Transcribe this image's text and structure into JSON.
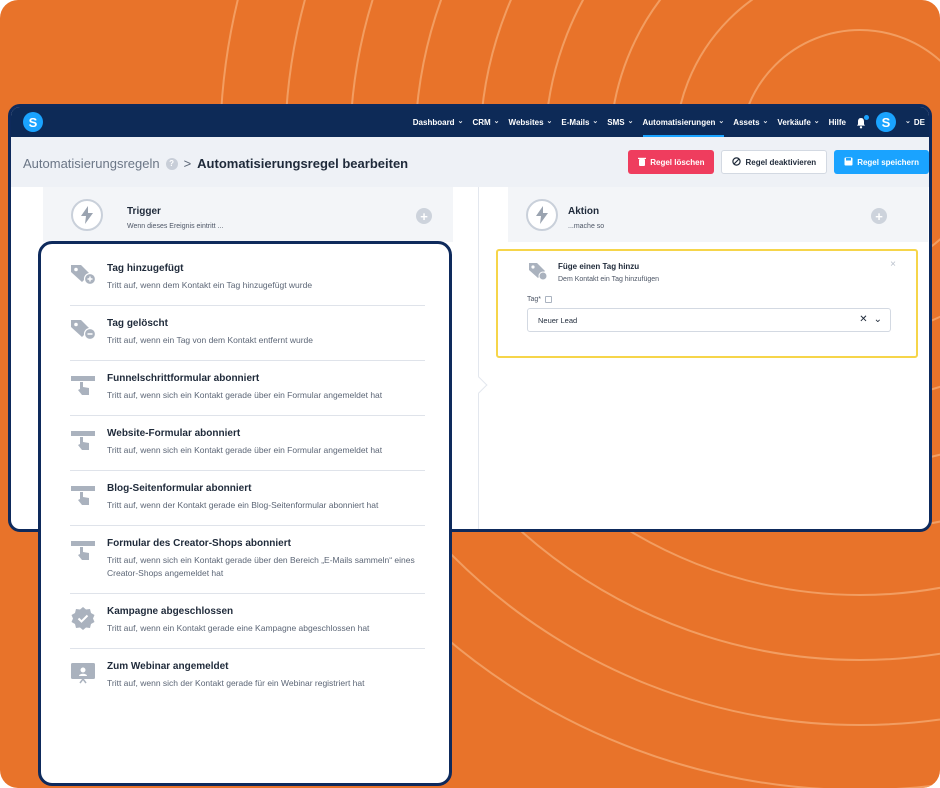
{
  "nav": {
    "items": [
      {
        "label": "Dashboard",
        "has_menu": true,
        "active": false
      },
      {
        "label": "CRM",
        "has_menu": true,
        "active": false
      },
      {
        "label": "Websites",
        "has_menu": true,
        "active": false
      },
      {
        "label": "E-Mails",
        "has_menu": true,
        "active": false
      },
      {
        "label": "SMS",
        "has_menu": true,
        "active": false
      },
      {
        "label": "Automatisierungen",
        "has_menu": true,
        "active": true
      },
      {
        "label": "Assets",
        "has_menu": true,
        "active": false
      },
      {
        "label": "Verkäufe",
        "has_menu": true,
        "active": false
      },
      {
        "label": "Hilfe",
        "has_menu": false,
        "active": false
      }
    ],
    "logo_letter": "S",
    "avatar_letter": "S",
    "language": "DE"
  },
  "breadcrumb": {
    "parent": "Automatisierungsregeln",
    "help_icon": "?",
    "separator": ">",
    "current": "Automatisierungsregel bearbeiten"
  },
  "actions": {
    "delete_label": "Regel löschen",
    "deactivate_label": "Regel deaktivieren",
    "save_label": "Regel speichern"
  },
  "trigger_header": {
    "title": "Trigger",
    "subtitle": "Wenn dieses Ereignis eintritt ..."
  },
  "action_header": {
    "title": "Aktion",
    "subtitle": "...mache so"
  },
  "action_card": {
    "title": "Füge einen Tag hinzu",
    "subtitle": "Dem Kontakt ein Tag hinzufügen",
    "field_label": "Tag*",
    "selected_value": "Neuer Lead",
    "close_glyph": "×"
  },
  "triggers": [
    {
      "title": "Tag hinzugefügt",
      "description": "Tritt auf, wenn dem Kontakt ein Tag hinzugefügt wurde",
      "icon": "tag-plus-icon"
    },
    {
      "title": "Tag gelöscht",
      "description": "Tritt auf, wenn ein Tag von dem Kontakt entfernt wurde",
      "icon": "tag-minus-icon"
    },
    {
      "title": "Funnelschrittformular abonniert",
      "description": "Tritt auf, wenn sich ein Kontakt gerade über ein Formular angemeldet hat",
      "icon": "form-pointer-icon"
    },
    {
      "title": "Website-Formular abonniert",
      "description": "Tritt auf, wenn sich ein Kontakt gerade über ein Formular angemeldet hat",
      "icon": "form-pointer-icon"
    },
    {
      "title": "Blog-Seitenformular abonniert",
      "description": "Tritt auf, wenn der Kontakt gerade ein Blog-Seitenformular abonniert hat",
      "icon": "form-pointer-icon"
    },
    {
      "title": "Formular des Creator-Shops abonniert",
      "description": "Tritt auf, wenn sich ein Kontakt gerade über den Bereich „E-Mails sammeln“ eines Creator-Shops angemeldet hat",
      "icon": "form-pointer-icon"
    },
    {
      "title": "Kampagne abgeschlossen",
      "description": "Tritt auf, wenn ein Kontakt gerade eine Kampagne abgeschlossen hat",
      "icon": "badge-check-icon"
    },
    {
      "title": "Zum Webinar angemeldet",
      "description": "Tritt auf, wenn sich der Kontakt gerade für ein Webinar registriert hat",
      "icon": "webinar-screen-icon"
    }
  ],
  "colors": {
    "background": "#e8732a",
    "nav": "#0d2a57",
    "accent": "#1aa3ff",
    "danger": "#ef3d5e",
    "highlight": "#f6d54a"
  }
}
